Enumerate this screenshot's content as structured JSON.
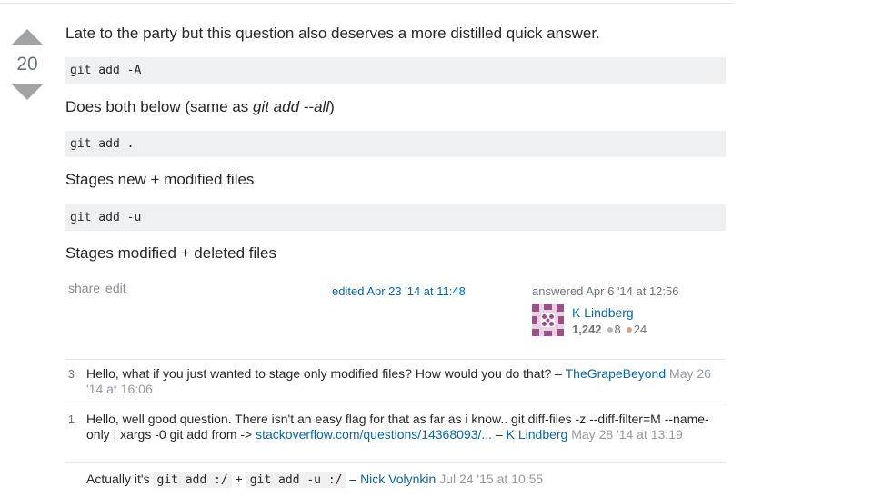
{
  "vote": {
    "score": "20"
  },
  "answer": {
    "intro": "Late to the party but this question also deserves a more distilled quick answer.",
    "code1": "git add -A",
    "desc1_prefix": "Does both below (same as ",
    "desc1_em": "git add --all",
    "desc1_suffix": ")",
    "code2": "git add .",
    "desc2": "Stages new + modified files",
    "code3": "git add -u",
    "desc3": "Stages modified + deleted files"
  },
  "menu": {
    "share": "share",
    "edit": "edit"
  },
  "edited": "edited Apr 23 '14 at 11:48",
  "answered": {
    "label": "answered Apr 6 '14 at 12:56",
    "user": "K Lindberg",
    "reputation": "1,242",
    "silver": "8",
    "bronze": "24"
  },
  "colors": {
    "link": "#0c65a5",
    "silver_badge": "#b4b8bc",
    "bronze_badge": "#d1a684",
    "avatar": "#9c4f8c"
  },
  "comments": [
    {
      "score": "3",
      "text": "Hello, what if you just wanted to stage only modified files? How would you do that?",
      "sep": " – ",
      "user": "TheGrapeBeyond",
      "date": "May 26 '14 at 16:06"
    },
    {
      "score": "1",
      "text": "Hello, well good question. There isn't an easy flag for that as far as i know.. git diff-files -z --diff-filter=M --name-only | xargs -0 git add from -> ",
      "link": "stackoverflow.com/questions/14368093/...",
      "sep": " – ",
      "user": "K Lindberg",
      "date": "May 28 '14 at 13:19"
    },
    {
      "score": "",
      "text_prefix": "Actually it's ",
      "code_a": "git add :/",
      "plus": " + ",
      "code_b": "git add -u :/",
      "sep": " – ",
      "user": "Nick Volynkin",
      "date": "Jul 24 '15 at 10:55"
    }
  ]
}
